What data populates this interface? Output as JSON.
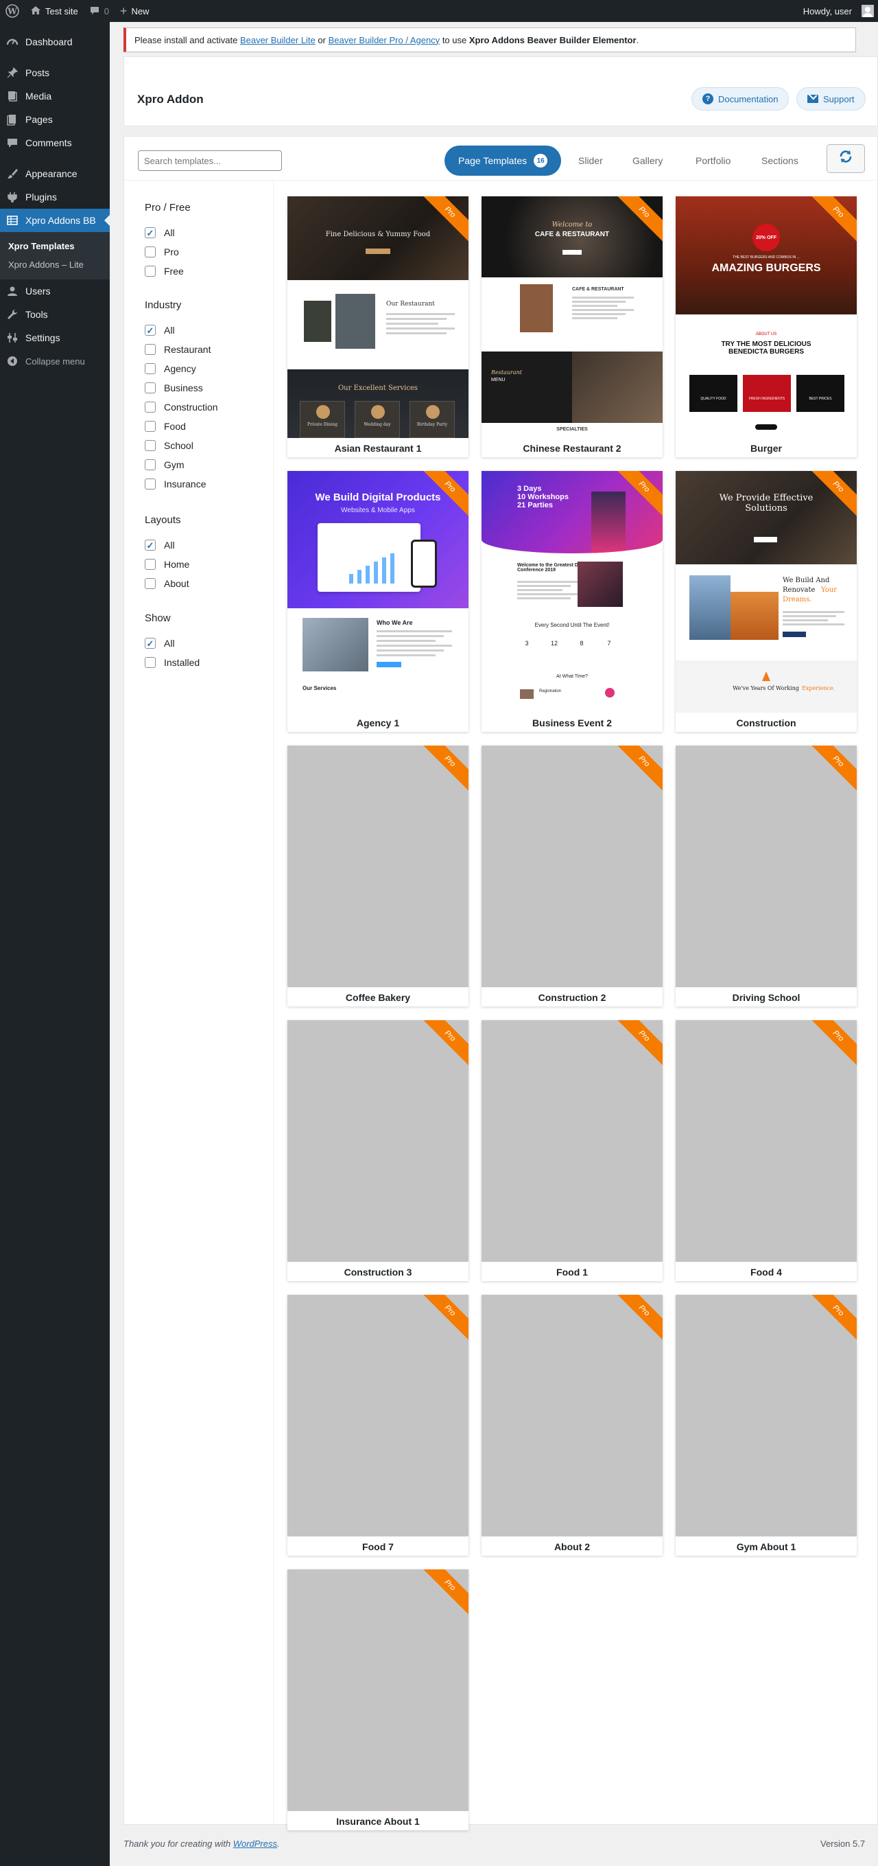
{
  "admin_bar": {
    "site_name": "Test site",
    "comments_count": "0",
    "new_label": "New",
    "greeting": "Howdy, user"
  },
  "sidebar": {
    "items": [
      {
        "label": "Dashboard",
        "icon": "dashboard-icon"
      },
      {
        "label": "Posts",
        "icon": "pin-icon"
      },
      {
        "label": "Media",
        "icon": "media-icon"
      },
      {
        "label": "Pages",
        "icon": "pages-icon"
      },
      {
        "label": "Comments",
        "icon": "comments-icon"
      },
      {
        "label": "Appearance",
        "icon": "brush-icon"
      },
      {
        "label": "Plugins",
        "icon": "plugin-icon"
      },
      {
        "label": "Xpro Addons BB",
        "icon": "grid-icon"
      },
      {
        "label": "Users",
        "icon": "users-icon"
      },
      {
        "label": "Tools",
        "icon": "wrench-icon"
      },
      {
        "label": "Settings",
        "icon": "settings-icon"
      }
    ],
    "submenu": [
      "Xpro Templates",
      "Xpro Addons – Lite"
    ],
    "collapse": "Collapse menu"
  },
  "notice": {
    "prefix": "Please install and activate",
    "link1": "Beaver Builder Lite",
    "or": "or",
    "link2": "Beaver Builder Pro / Agency",
    "mid": "to use",
    "strong": "Xpro Addons Beaver Builder Elementor",
    "end": "."
  },
  "header": {
    "title": "Xpro Addon",
    "documentation": "Documentation",
    "support": "Support"
  },
  "toolbar": {
    "search_placeholder": "Search templates...",
    "tabs": [
      "Page Templates",
      "Slider",
      "Gallery",
      "Portfolio",
      "Sections"
    ],
    "count": "16"
  },
  "filters": [
    {
      "heading": "Pro / Free",
      "options": [
        {
          "label": "All",
          "checked": true
        },
        {
          "label": "Pro",
          "checked": false
        },
        {
          "label": "Free",
          "checked": false
        }
      ]
    },
    {
      "heading": "Industry",
      "options": [
        {
          "label": "All",
          "checked": true
        },
        {
          "label": "Restaurant",
          "checked": false
        },
        {
          "label": "Agency",
          "checked": false
        },
        {
          "label": "Business",
          "checked": false
        },
        {
          "label": "Construction",
          "checked": false
        },
        {
          "label": "Food",
          "checked": false
        },
        {
          "label": "School",
          "checked": false
        },
        {
          "label": "Gym",
          "checked": false
        },
        {
          "label": "Insurance",
          "checked": false
        }
      ]
    },
    {
      "heading": "Layouts",
      "options": [
        {
          "label": "All",
          "checked": true
        },
        {
          "label": "Home",
          "checked": false
        },
        {
          "label": "About",
          "checked": false
        }
      ]
    },
    {
      "heading": "Show",
      "options": [
        {
          "label": "All",
          "checked": true
        },
        {
          "label": "Installed",
          "checked": false
        }
      ]
    }
  ],
  "ribbon": "Pro",
  "templates": [
    {
      "name": "Asian Restaurant 1"
    },
    {
      "name": "Chinese Restaurant 2"
    },
    {
      "name": "Burger"
    },
    {
      "name": "Agency 1"
    },
    {
      "name": "Business Event 2"
    },
    {
      "name": "Construction"
    },
    {
      "name": "Coffee Bakery"
    },
    {
      "name": "Construction 2"
    },
    {
      "name": "Driving School"
    },
    {
      "name": "Construction 3"
    },
    {
      "name": "Food 1"
    },
    {
      "name": "Food 4"
    },
    {
      "name": "Food 7"
    },
    {
      "name": "About 2"
    },
    {
      "name": "Gym About 1"
    },
    {
      "name": "Insurance About 1"
    }
  ],
  "previews": {
    "asian": {
      "headline": "Fine Delicious & Yummy Food",
      "section1": "Our Restaurant",
      "section2": "Our Excellent Services",
      "services": [
        "Private Dining",
        "Wedding day",
        "Birthday Party"
      ]
    },
    "chinese": {
      "headline1": "Welcome to",
      "headline2": "CAFE & RESTAURANT",
      "section1": "CAFE & RESTAURANT",
      "menu1": "Restaurant",
      "menu2": "MENU",
      "specialties": "SPECIALTIES"
    },
    "burger": {
      "promo": "20% OFF",
      "kicker": "THE BEST BURGERS AND COMBOS IN ...",
      "headline": "AMAZING BURGERS",
      "about": "ABOUT US",
      "subhead": "TRY THE MOST DELICIOUS BENEDICTA BURGERS",
      "features": [
        "QUALITY FOOD",
        "FRESH INGREDIENTS",
        "BEST PRICES"
      ]
    },
    "agency": {
      "headline": "We Build Digital Products",
      "sub": "Websites & Mobile Apps",
      "section1": "Who We Are",
      "section2": "Our Services"
    },
    "event": {
      "headline": "3 Days\n10 Workshops\n21 Parties",
      "section1": "Welcome to the Greatest Digital Conference 2019",
      "countdown_title": "Every Second Until The Event!",
      "countdown": [
        "3",
        "12",
        "8",
        "7"
      ],
      "schedule": "At What Time?",
      "registration": "Registration"
    },
    "construction": {
      "headline": "We Provide Effective Solutions",
      "build1": "We Build And",
      "build2": "Renovate",
      "build3": "Your",
      "build4": "Dreams.",
      "years": "We've Years Of Working",
      "years_accent": "Experience."
    }
  },
  "footer": {
    "text": "Thank you for creating with",
    "link": "WordPress",
    "version": "Version 5.7"
  },
  "colors": {
    "accent": "#2271b1",
    "ribbon": "#f57c00",
    "admin": "#1d2327",
    "notice": "#d63638"
  }
}
